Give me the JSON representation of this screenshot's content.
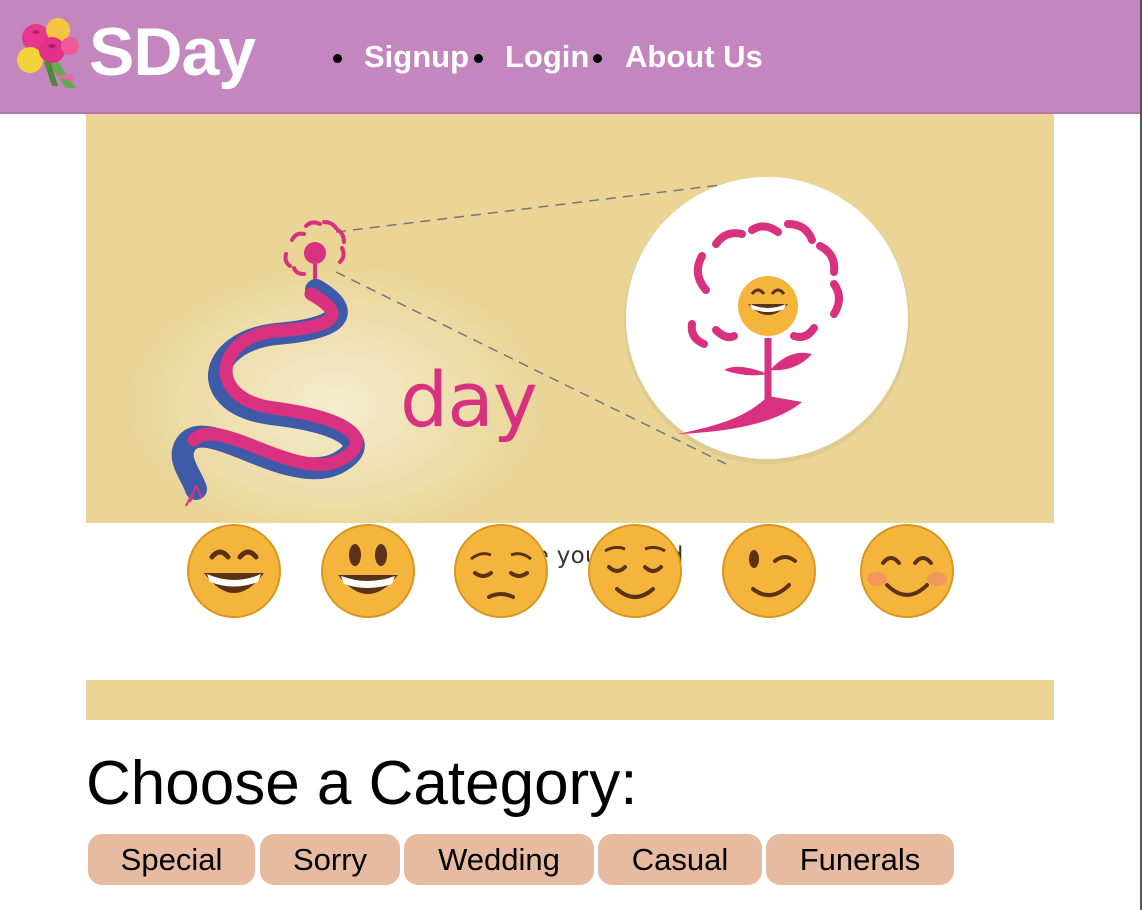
{
  "header": {
    "brand": "SDay",
    "brand_icon": "bouquet-icon",
    "nav": [
      {
        "label": "Signup"
      },
      {
        "label": "Login"
      },
      {
        "label": "About Us"
      }
    ]
  },
  "banner": {
    "logo_text": "day",
    "logo_icon": "flower-logo-icon",
    "mood_title": "Choose your mood",
    "moods": [
      {
        "name": "grinning-smiling-eyes"
      },
      {
        "name": "smiley-open-mouth"
      },
      {
        "name": "pensive"
      },
      {
        "name": "relieved"
      },
      {
        "name": "winking"
      },
      {
        "name": "blushing"
      }
    ]
  },
  "categories": {
    "heading": "Choose a Category:",
    "buttons": [
      "Special",
      "Sorry",
      "Wedding",
      "Casual",
      "Funerals"
    ]
  },
  "colors": {
    "navbar": "#c386bf",
    "banner": "#ead596",
    "button": "#e7bba1",
    "logo_pink": "#d8317f",
    "logo_blue": "#3e5aa8"
  }
}
